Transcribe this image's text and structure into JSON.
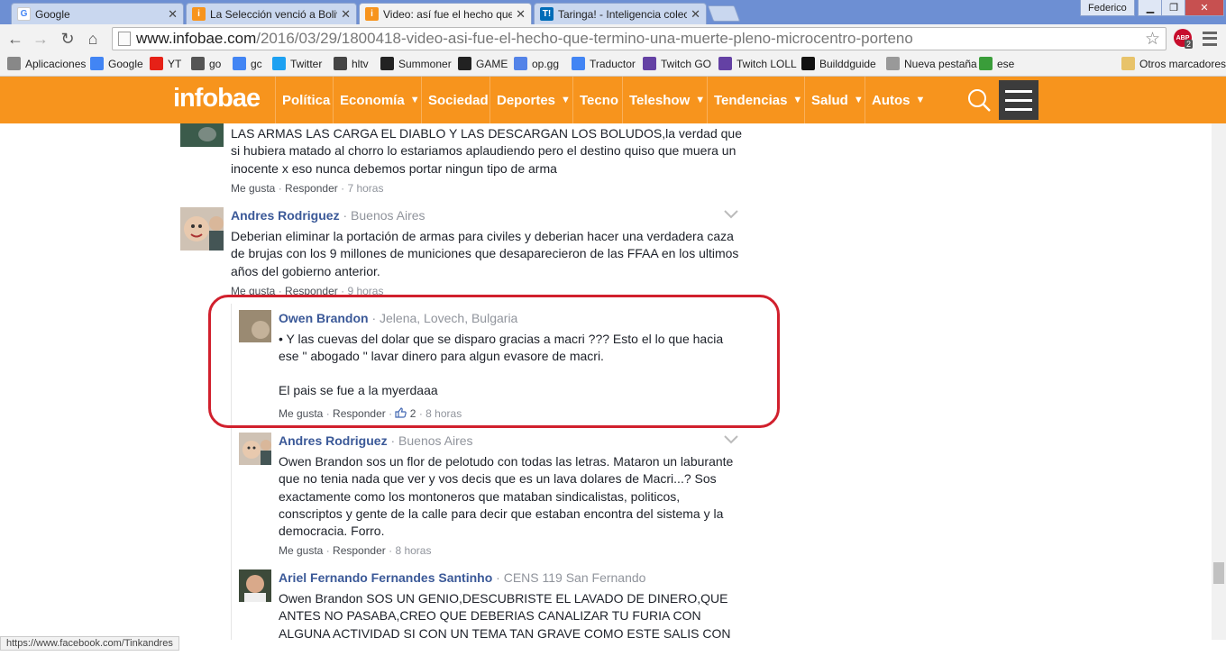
{
  "browser": {
    "tabs": [
      {
        "title": "Google",
        "favicon": "google-icon",
        "color": "#4285f4"
      },
      {
        "title": "La Selección venció a Bolivia",
        "favicon": "infobae-icon",
        "color": "#f7941d"
      },
      {
        "title": "Video: así fue el hecho que termino",
        "favicon": "infobae-icon",
        "color": "#f7941d"
      },
      {
        "title": "Taringa! - Inteligencia colectiva",
        "favicon": "taringa-icon",
        "color": "#006cb7"
      }
    ],
    "profile_name": "Federico",
    "url_host": "www.infobae.com",
    "url_path": "/2016/03/29/1800418-video-asi-fue-el-hecho-que-termino-una-muerte-pleno-microcentro-porteno",
    "abp_badge": "ABP",
    "abp_count": "2",
    "bookmarks": [
      {
        "label": "Aplicaciones",
        "icon": "apps-icon",
        "color": "#888"
      },
      {
        "label": "Google",
        "icon": "google-icon",
        "color": "#4285f4"
      },
      {
        "label": "YT",
        "icon": "youtube-icon",
        "color": "#e62117"
      },
      {
        "label": "go",
        "icon": "reddit-icon",
        "color": "#555"
      },
      {
        "label": "gc",
        "icon": "google-icon",
        "color": "#4285f4"
      },
      {
        "label": "Twitter",
        "icon": "twitter-icon",
        "color": "#1da1f2"
      },
      {
        "label": "hltv",
        "icon": "hltv-icon",
        "color": "#444"
      },
      {
        "label": "Summoner",
        "icon": "summoner-icon",
        "color": "#222"
      },
      {
        "label": "GAME",
        "icon": "game-icon",
        "color": "#222"
      },
      {
        "label": "op.gg",
        "icon": "opgg-icon",
        "color": "#5383e8"
      },
      {
        "label": "Traductor",
        "icon": "translate-icon",
        "color": "#4285f4"
      },
      {
        "label": "Twitch GO",
        "icon": "twitch-icon",
        "color": "#6441a4"
      },
      {
        "label": "Twitch LOLL",
        "icon": "twitch-icon",
        "color": "#6441a4"
      },
      {
        "label": "Builddguide",
        "icon": "probuilds-icon",
        "color": "#111"
      },
      {
        "label": "Nueva pestaña",
        "icon": "page-icon",
        "color": "#999"
      },
      {
        "label": "ese",
        "icon": "ese-icon",
        "color": "#3a9d3a"
      }
    ],
    "other_bookmarks": "Otros marcadores",
    "status_url": "https://www.facebook.com/Tinkandres"
  },
  "site": {
    "logo": "infobae",
    "brand_color": "#f7941d",
    "nav": [
      {
        "label": "Política",
        "dropdown": false
      },
      {
        "label": "Economía",
        "dropdown": true
      },
      {
        "label": "Sociedad",
        "dropdown": false
      },
      {
        "label": "Deportes",
        "dropdown": true
      },
      {
        "label": "Tecno",
        "dropdown": false
      },
      {
        "label": "Teleshow",
        "dropdown": true
      },
      {
        "label": "Tendencias",
        "dropdown": true
      },
      {
        "label": "Salud",
        "dropdown": true
      },
      {
        "label": "Autos",
        "dropdown": true
      }
    ]
  },
  "comments": [
    {
      "author": "",
      "location": "",
      "text": "LAS ARMAS LAS CARGA EL DIABLO Y LAS DESCARGAN LOS BOLUDOS,la verdad que si hubiera matado al chorro lo estariamos aplaudiendo pero el destino quiso que muera un inocente x eso nunca debemos portar ningun tipo de arma",
      "like": "Me gusta",
      "reply": "Responder",
      "time": "7 horas",
      "likes": ""
    },
    {
      "author": "Andres Rodriguez",
      "location": "Buenos Aires",
      "text": "Deberian eliminar la portación de armas para civiles y deberian hacer una verdadera caza de brujas con los 9 millones de municiones que desaparecieron de las FFAA en los ultimos años del gobierno anterior.",
      "like": "Me gusta",
      "reply": "Responder",
      "time": "9 horas",
      "likes": ""
    },
    {
      "author": "Owen Brandon",
      "location": "Jelena, Lovech, Bulgaria",
      "text": "• Y las cuevas del dolar que se disparo gracias a macri ??? Esto el lo que hacia ese \" abogado \" lavar dinero para algun evasore de macri.",
      "text2": "El pais se fue a la myerdaaa",
      "like": "Me gusta",
      "reply": "Responder",
      "time": "8 horas",
      "likes": "2"
    },
    {
      "author": "Andres Rodriguez",
      "location": "Buenos Aires",
      "text": "Owen Brandon sos un flor de pelotudo con todas las letras. Mataron un laburante que no tenia nada que ver y vos decis que es un lava dolares de Macri...? Sos exactamente como los montoneros que mataban sindicalistas, politicos, conscriptos y gente de la calle para decir que estaban encontra del sistema y la democracia. Forro.",
      "like": "Me gusta",
      "reply": "Responder",
      "time": "8 horas",
      "likes": ""
    },
    {
      "author": "Ariel Fernando Fernandes Santinho",
      "location": "CENS 119 San Fernando",
      "text": "Owen Brandon SOS UN GENIO,DESCUBRISTE EL LAVADO DE DINERO,QUE ANTES NO PASABA,CREO QUE DEBERIAS CANALIZAR TU FURIA CON ALGUNA ACTIVIDAD SI CON UN TEMA TAN GRAVE COMO ESTE SALIS CON BRE LA GENTE QUE TE TIENE QUE SOPORTAR A",
      "like": "",
      "reply": "",
      "time": "",
      "likes": ""
    }
  ],
  "separator": "·"
}
